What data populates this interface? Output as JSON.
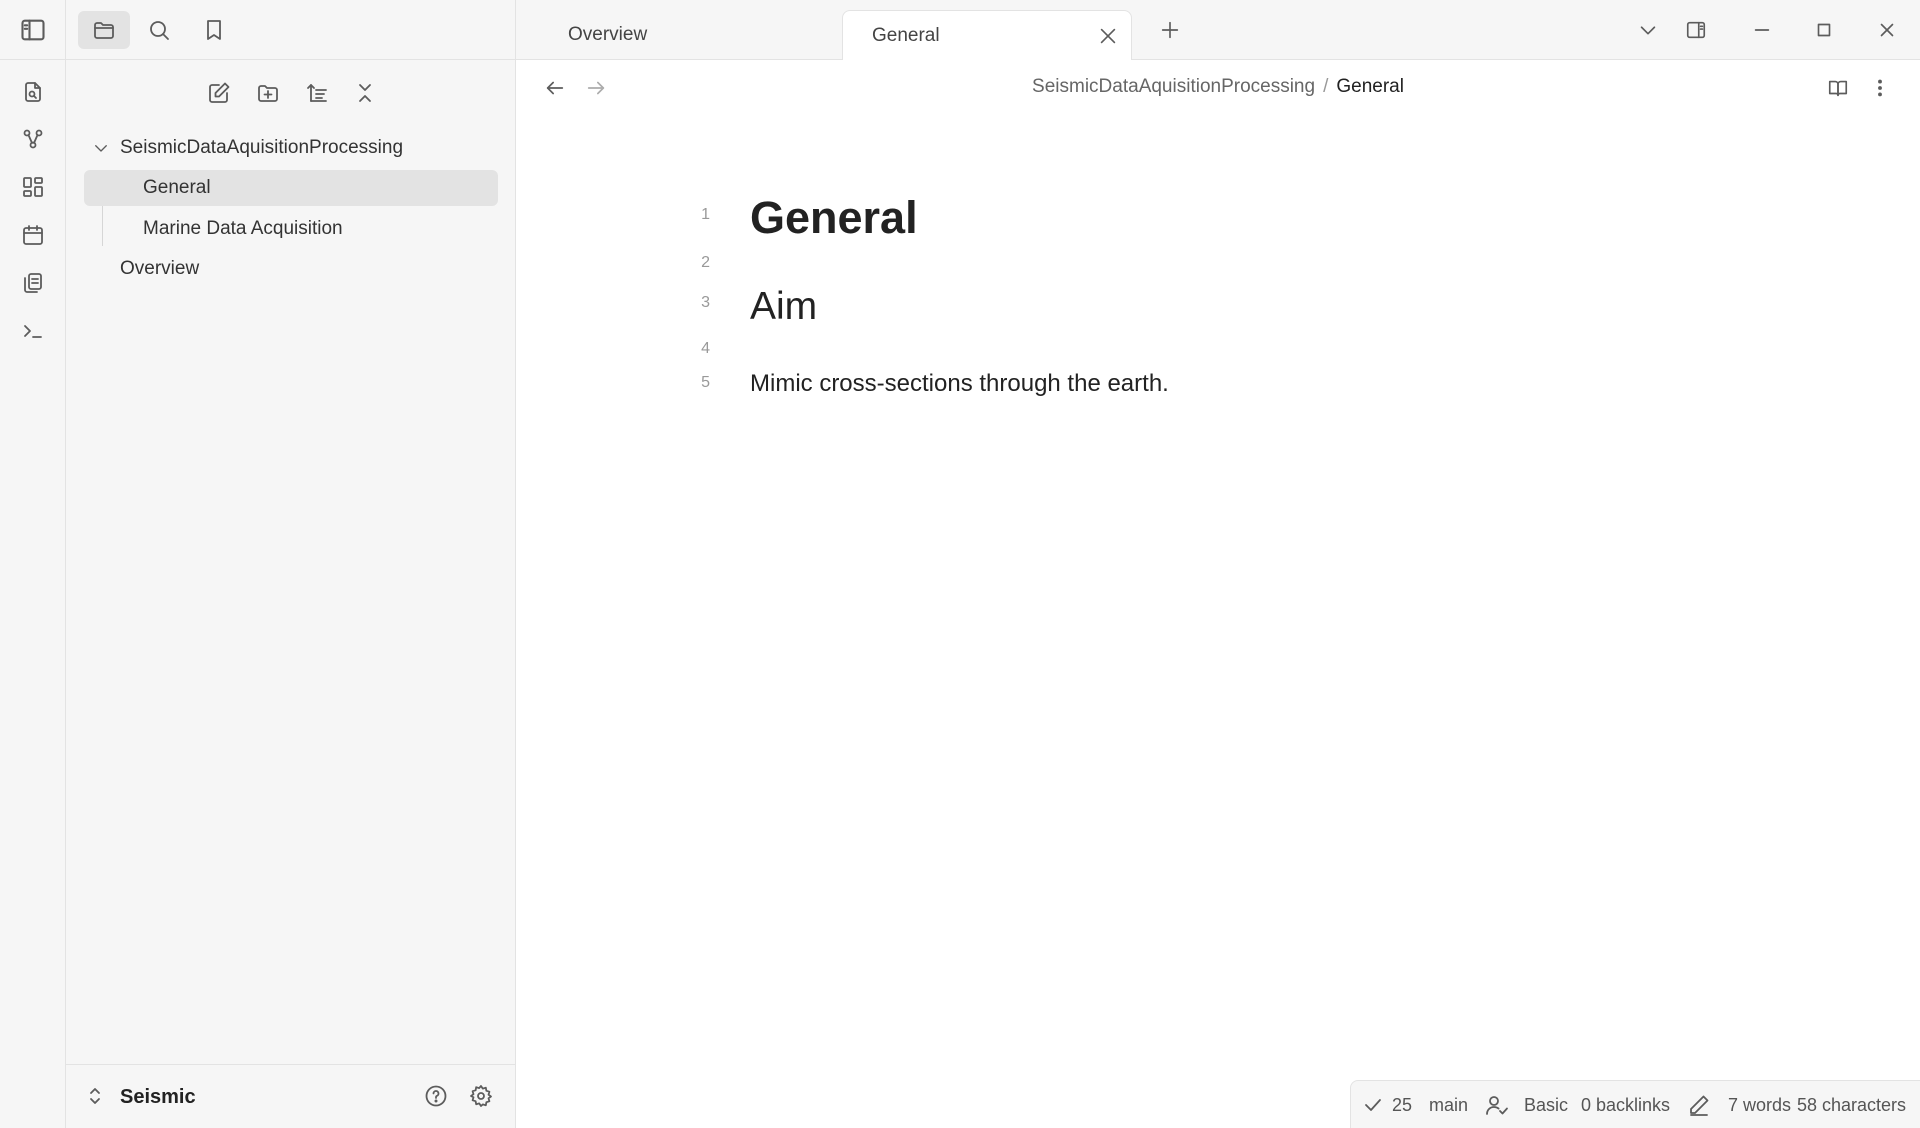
{
  "sidebar": {
    "tabs": [
      {
        "name": "files-icon",
        "active": true
      },
      {
        "name": "search-icon",
        "active": false
      },
      {
        "name": "bookmark-icon",
        "active": false
      }
    ],
    "tree": {
      "folder": "SeismicDataAquisitionProcessing",
      "children": [
        "General",
        "Marine Data Acquisition"
      ],
      "root_file": "Overview"
    },
    "vault_name": "Seismic"
  },
  "tabs": [
    {
      "label": "Overview",
      "active": false
    },
    {
      "label": "General",
      "active": true
    }
  ],
  "breadcrumb": {
    "folder": "SeismicDataAquisitionProcessing",
    "separator": "/",
    "current": "General"
  },
  "editor": {
    "lines": [
      {
        "number": "1",
        "text": "General",
        "style": "h1"
      },
      {
        "number": "2",
        "text": "",
        "style": "blank"
      },
      {
        "number": "3",
        "text": "Aim",
        "style": "h2"
      },
      {
        "number": "4",
        "text": "",
        "style": "blank"
      },
      {
        "number": "5",
        "text": "Mimic cross-sections through the earth.",
        "style": "para"
      }
    ]
  },
  "statusbar": {
    "sync_count": "25",
    "branch": "main",
    "mode": "Basic",
    "backlinks": "0 backlinks",
    "words": "7 words",
    "characters": "58 characters"
  },
  "colors": {
    "panel_bg": "#f6f6f6",
    "editor_bg": "#ffffff",
    "selected_bg": "#e3e3e3",
    "border": "#e3e3e3"
  }
}
